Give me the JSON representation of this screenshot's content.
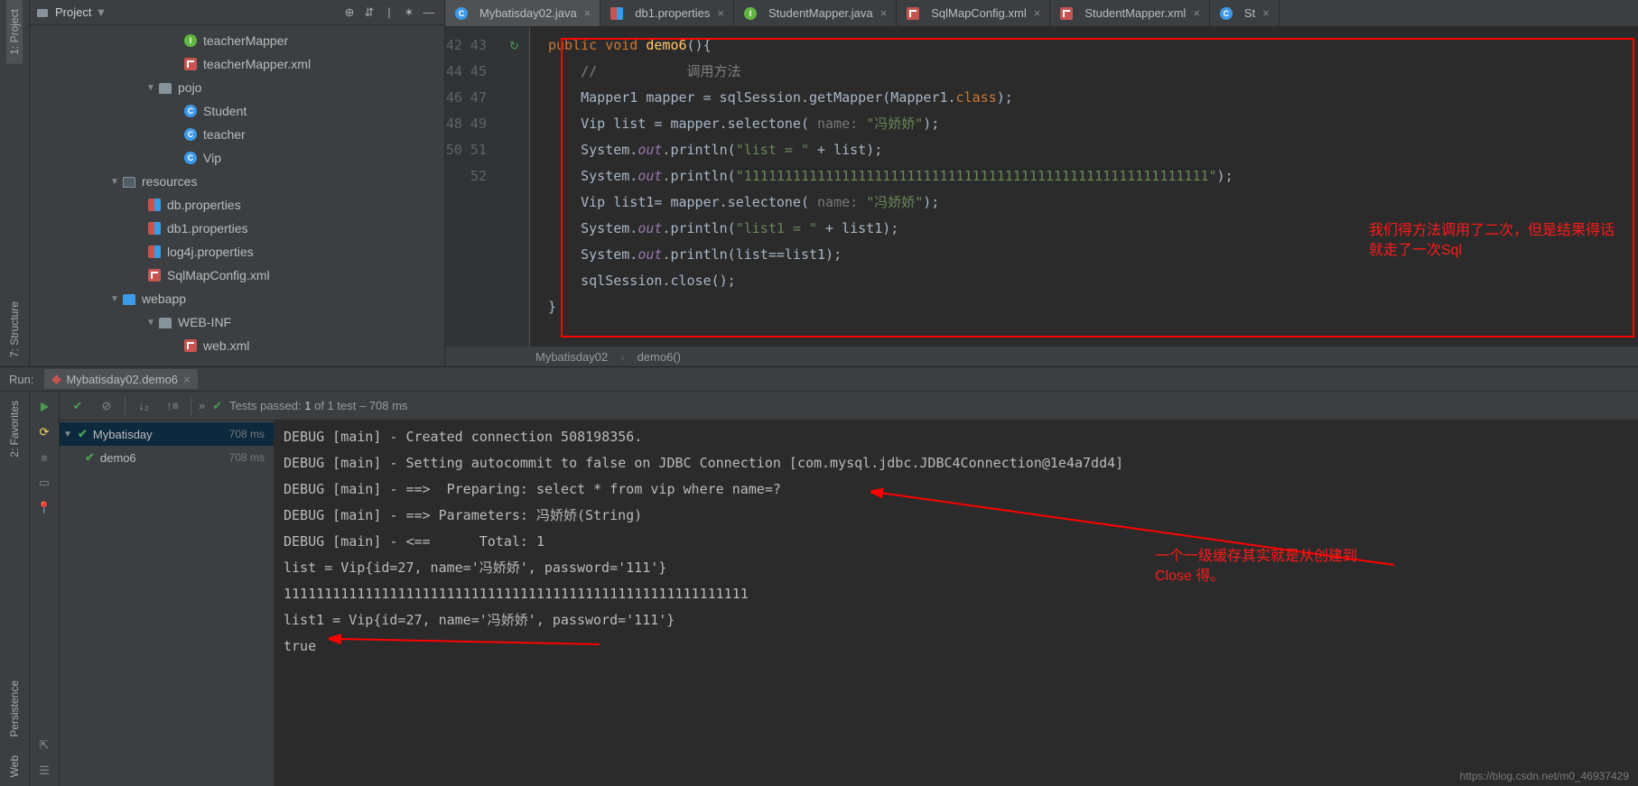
{
  "projectPanel": {
    "title": "Project"
  },
  "tree": {
    "n0": "teacherMapper",
    "n1": "teacherMapper.xml",
    "pojo": "pojo",
    "student": "Student",
    "teacher": "teacher",
    "vip": "Vip",
    "resources": "resources",
    "dbp": "db.properties",
    "db1p": "db1.properties",
    "log4j": "log4j.properties",
    "sqlmap": "SqlMapConfig.xml",
    "webapp": "webapp",
    "webinf": "WEB-INF",
    "webxml": "web.xml"
  },
  "tabs": [
    {
      "label": "Mybatisday02.java",
      "kind": "class",
      "active": true
    },
    {
      "label": "db1.properties",
      "kind": "prop",
      "active": false
    },
    {
      "label": "StudentMapper.java",
      "kind": "iface",
      "active": false
    },
    {
      "label": "SqlMapConfig.xml",
      "kind": "xml",
      "active": false
    },
    {
      "label": "StudentMapper.xml",
      "kind": "xml",
      "active": false
    },
    {
      "label": "St",
      "kind": "class",
      "active": false
    }
  ],
  "lines": {
    "start": 42,
    "end": 52
  },
  "code": {
    "sig": "public void demo6(){",
    "c1": "//           调用方法",
    "l44a": "Mapper1 mapper = sqlSession.getMapper(Mapper1.",
    "l44b": "class",
    "l44c": ");",
    "l45a": "Vip list = mapper.selectone( ",
    "l45hint": "name: ",
    "l45b": "\"冯娇娇\"",
    "l45c": ");",
    "l46a": "System.",
    "l46out": "out",
    "l46b": ".println(",
    "l46s": "\"list = \"",
    "l46c": " + list);",
    "l47s": "\"111111111111111111111111111111111111111111111111111111111\"",
    "l47c": ");",
    "l48a": "Vip list1= mapper.selectone( ",
    "l49s": "\"list1 = \"",
    "l49c": " + list1);",
    "l50c": ".println(list==list1);",
    "l51a": "sqlSession.close();",
    "l52": "}"
  },
  "annotation1_l1": "我们得方法调用了二次，但是结果得话",
  "annotation1_l2": "就走了一次Sql",
  "annotation2_l1": "一个一级缓存其实就是从创建到",
  "annotation2_l2": "Close 得。",
  "breadcrumb": {
    "cls": "Mybatisday02",
    "m": "demo6()"
  },
  "run": {
    "label": "Run:",
    "tab": "Mybatisday02.demo6",
    "testsPrefix": "Tests passed: ",
    "testsCount": "1",
    "testsOf": " of 1 test – 708 ms",
    "tree": {
      "root": "Mybatisday",
      "rootTime": "708 ms",
      "leaf": "demo6",
      "leafTime": "708 ms"
    }
  },
  "console": [
    "DEBUG [main] - Created connection 508198356.",
    "DEBUG [main] - Setting autocommit to false on JDBC Connection [com.mysql.jdbc.JDBC4Connection@1e4a7dd4]",
    "DEBUG [main] - ==>  Preparing: select * from vip where name=?",
    "DEBUG [main] - ==> Parameters: 冯娇娇(String)",
    "DEBUG [main] - <==      Total: 1",
    "list = Vip{id=27, name='冯娇娇', password='111'}",
    "111111111111111111111111111111111111111111111111111111111",
    "list1 = Vip{id=27, name='冯娇娇', password='111'}",
    "true"
  ],
  "leftTabs": [
    "1: Project",
    "7: Structure"
  ],
  "bottomLeftTabs": [
    "2: Favorites",
    "Persistence",
    "Web"
  ],
  "watermark": "https://blog.csdn.net/m0_46937429"
}
